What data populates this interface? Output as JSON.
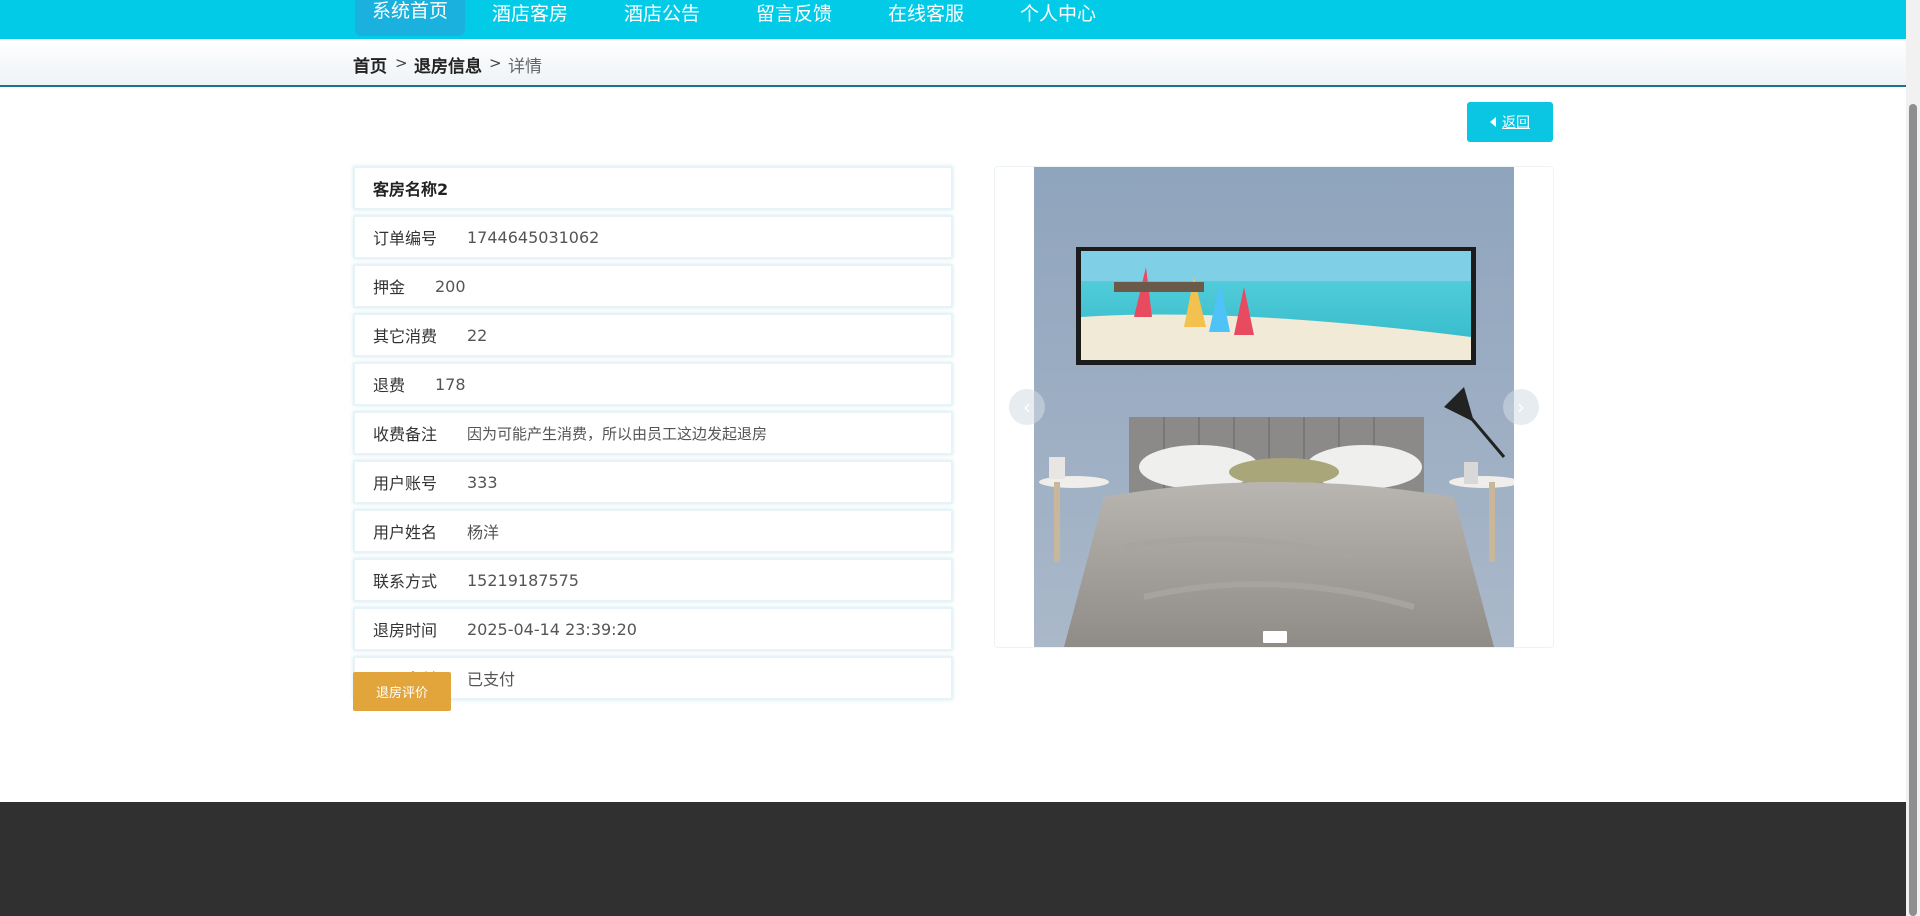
{
  "nav": {
    "items": [
      {
        "label": "系统首页",
        "active": true
      },
      {
        "label": "酒店客房"
      },
      {
        "label": "酒店公告"
      },
      {
        "label": "留言反馈"
      },
      {
        "label": "在线客服"
      },
      {
        "label": "个人中心"
      }
    ],
    "color": "#02cbe8"
  },
  "breadcrumb": {
    "home": "首页",
    "section": "退房信息",
    "current": "详情",
    "separator": ">"
  },
  "back_button": {
    "label": "返回",
    "icon": "caret-left-icon"
  },
  "detail": {
    "title": "客房名称2",
    "rows": [
      {
        "label": "订单编号",
        "value": "1744645031062"
      },
      {
        "label": "押金",
        "value": "200"
      },
      {
        "label": "其它消费",
        "value": "22"
      },
      {
        "label": "退费",
        "value": "178"
      },
      {
        "label": "收费备注",
        "value": "因为可能产生消费，所以由员工这边发起退房"
      },
      {
        "label": "用户账号",
        "value": "333"
      },
      {
        "label": "用户姓名",
        "value": "杨洋"
      },
      {
        "label": "联系方式",
        "value": "15219187575"
      },
      {
        "label": "退房时间",
        "value": "2025-04-14 23:39:20"
      },
      {
        "label": "是否支付",
        "value": "已支付"
      }
    ]
  },
  "review_button": {
    "label": "退房评价",
    "color": "#e2a53b"
  },
  "carousel": {
    "prev_icon": "chevron-left-icon",
    "next_icon": "chevron-right-icon",
    "slides": 1,
    "active_index": 0
  }
}
